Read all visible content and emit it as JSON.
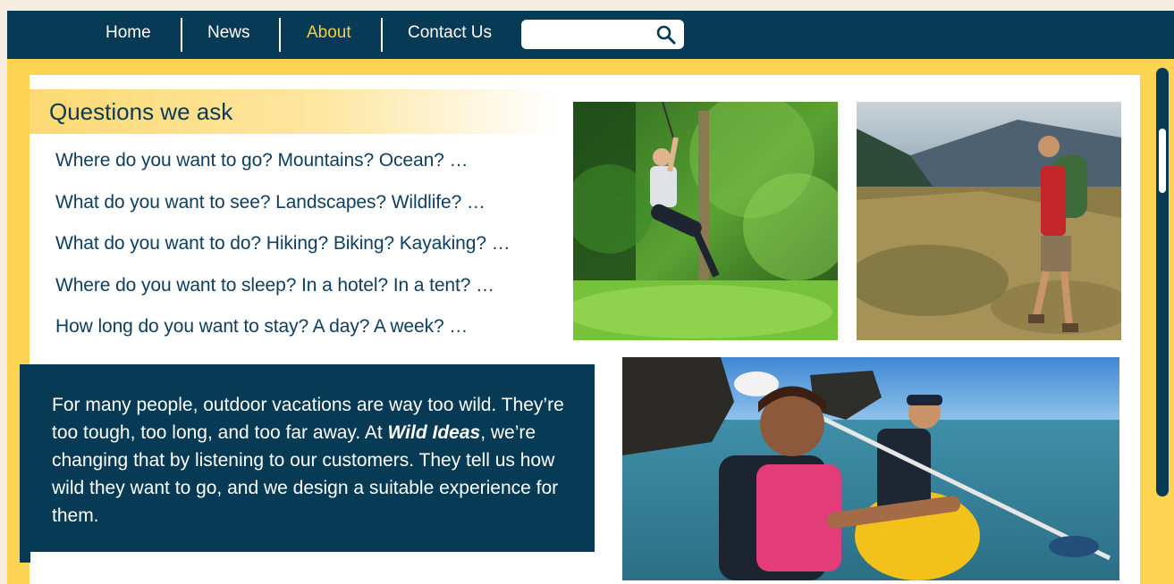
{
  "nav": {
    "items": [
      {
        "label": "Home"
      },
      {
        "label": "News"
      },
      {
        "label": "About"
      },
      {
        "label": "Contact Us"
      }
    ],
    "active": "About",
    "search": {
      "value": "",
      "placeholder": ""
    }
  },
  "questions": {
    "title": "Questions we ask",
    "items": [
      "Where do you want to go? Mountains? Ocean? …",
      "What do you want to see? Landscapes? Wildlife? …",
      "What do you want to do? Hiking? Biking? Kayaking? …",
      "Where do you want to sleep? In a hotel? In a tent? …",
      "How long do you want to stay? A day? A week? …"
    ]
  },
  "intro": {
    "text_before": "For many people, outdoor vacations are way too wild. They’re too tough, too long, and too far away. At ",
    "brand": "Wild Ideas",
    "text_after": ", we’re changing that by listening to our customers. They tell us how wild they want to go, and we design a suitable experience for them."
  },
  "colors": {
    "navy": "#073a55",
    "yellow": "#fcd451",
    "active_nav": "#f5cf45",
    "text_dark": "#0e3e60"
  },
  "icons": {
    "search": "search-icon"
  }
}
